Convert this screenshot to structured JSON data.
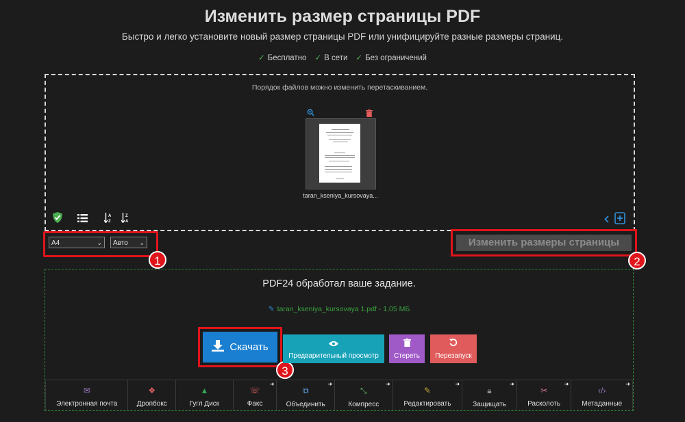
{
  "header": {
    "title": "Изменить размер страницы PDF",
    "subtitle": "Быстро и легко установите новый размер страницы PDF или унифицируйте разные размеры страниц.",
    "features": [
      "Бесплатно",
      "В сети",
      "Без ограничений"
    ]
  },
  "dropzone": {
    "hint": "Порядок файлов можно изменить перетаскиванием.",
    "file_name": "taran_kseniya_kursovaya..."
  },
  "options": {
    "page_size": "A4",
    "orientation": "Авто",
    "resize_button": "Изменить размеры страницы"
  },
  "result": {
    "status": "PDF24 обработал ваше задание.",
    "file_link": "taran_kseniya_kursovaya 1.pdf - 1,05 МБ",
    "download": "Скачать",
    "preview": "Предварительный просмотр",
    "erase": "Стереть",
    "restart": "Перезапуск"
  },
  "badges": [
    "1",
    "2",
    "3"
  ],
  "tools": [
    {
      "label": "Электронная почта",
      "icon": "mail-icon",
      "color": "#a07cc5",
      "ext": false
    },
    {
      "label": "Дропбокс",
      "icon": "dropbox-icon",
      "color": "#e06060",
      "ext": false
    },
    {
      "label": "Гугл Диск",
      "icon": "google-drive-icon",
      "color": "#34a853",
      "ext": false
    },
    {
      "label": "Факс",
      "icon": "fax-icon",
      "color": "#e06060",
      "ext": true
    },
    {
      "label": "Объединить",
      "icon": "merge-icon",
      "color": "#5aa0e0",
      "ext": true
    },
    {
      "label": "Компресс",
      "icon": "compress-icon",
      "color": "#5cb85c",
      "ext": true
    },
    {
      "label": "Редактировать",
      "icon": "edit-icon",
      "color": "#c8a040",
      "ext": true
    },
    {
      "label": "Защищать",
      "icon": "lock-icon",
      "color": "#8a8a8a",
      "ext": true
    },
    {
      "label": "Расколоть",
      "icon": "scissors-icon",
      "color": "#d070a0",
      "ext": true
    },
    {
      "label": "Метаданные",
      "icon": "code-icon",
      "color": "#a07cc5",
      "ext": true
    }
  ],
  "colors": {
    "accent_blue": "#1a7fd0",
    "highlight_red": "#e0141b",
    "success_green": "#3aa140"
  }
}
